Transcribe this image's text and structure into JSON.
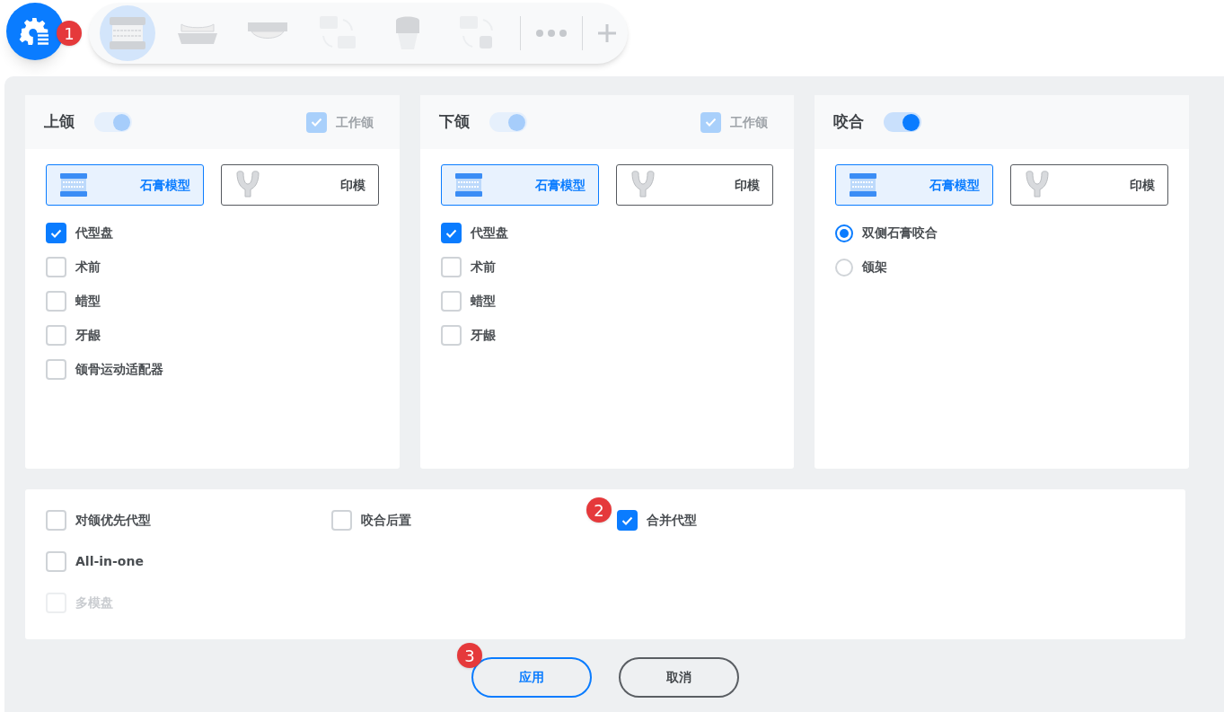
{
  "toolbar": {
    "badge": "1",
    "items": [
      {
        "kind": "full-arch",
        "selected": true
      },
      {
        "kind": "lower-arch",
        "selected": false
      },
      {
        "kind": "upper-arch",
        "selected": false
      },
      {
        "kind": "split",
        "selected": false
      },
      {
        "kind": "crown",
        "selected": false
      },
      {
        "kind": "split-crown",
        "selected": false
      }
    ]
  },
  "panels": [
    {
      "title": "上颌",
      "toggle": {
        "on": true,
        "disabled": true
      },
      "working_jaw": {
        "label": "工作颌",
        "checked": true,
        "disabled": true
      },
      "model_types": [
        {
          "kind": "plaster",
          "label": "石膏模型",
          "selected": true
        },
        {
          "kind": "impression",
          "label": "印模",
          "selected": false
        }
      ],
      "options": [
        {
          "kind": "checkbox",
          "label": "代型盘",
          "checked": true
        },
        {
          "kind": "checkbox",
          "label": "术前",
          "checked": false
        },
        {
          "kind": "checkbox",
          "label": "蜡型",
          "checked": false
        },
        {
          "kind": "checkbox",
          "label": "牙龈",
          "checked": false
        },
        {
          "kind": "checkbox",
          "label": "颌骨运动适配器",
          "checked": false
        }
      ]
    },
    {
      "title": "下颌",
      "toggle": {
        "on": true,
        "disabled": true
      },
      "working_jaw": {
        "label": "工作颌",
        "checked": true,
        "disabled": true
      },
      "model_types": [
        {
          "kind": "plaster",
          "label": "石膏模型",
          "selected": true
        },
        {
          "kind": "impression",
          "label": "印模",
          "selected": false
        }
      ],
      "options": [
        {
          "kind": "checkbox",
          "label": "代型盘",
          "checked": true
        },
        {
          "kind": "checkbox",
          "label": "术前",
          "checked": false
        },
        {
          "kind": "checkbox",
          "label": "蜡型",
          "checked": false
        },
        {
          "kind": "checkbox",
          "label": "牙龈",
          "checked": false
        }
      ]
    },
    {
      "title": "咬合",
      "toggle": {
        "on": true,
        "disabled": false
      },
      "model_types": [
        {
          "kind": "plaster",
          "label": "石膏模型",
          "selected": true
        },
        {
          "kind": "impression",
          "label": "印模",
          "selected": false
        }
      ],
      "options": [
        {
          "kind": "radio",
          "label": "双侧石膏咬合",
          "selected": true
        },
        {
          "kind": "radio",
          "label": "颌架",
          "selected": false
        }
      ]
    }
  ],
  "general_options": [
    [
      {
        "label": "对颌优先代型",
        "checked": false,
        "disabled": false
      },
      {
        "label": "咬合后置",
        "checked": false,
        "disabled": false
      },
      {
        "label": "合并代型",
        "checked": true,
        "disabled": false,
        "badge": "2"
      }
    ],
    [
      {
        "label": "All-in-one",
        "checked": false,
        "disabled": false
      }
    ],
    [
      {
        "label": "多模盘",
        "checked": false,
        "disabled": true
      }
    ]
  ],
  "buttons": [
    {
      "kind": "primary",
      "label": "应用",
      "badge": "3"
    },
    {
      "kind": "secondary",
      "label": "取消"
    }
  ]
}
